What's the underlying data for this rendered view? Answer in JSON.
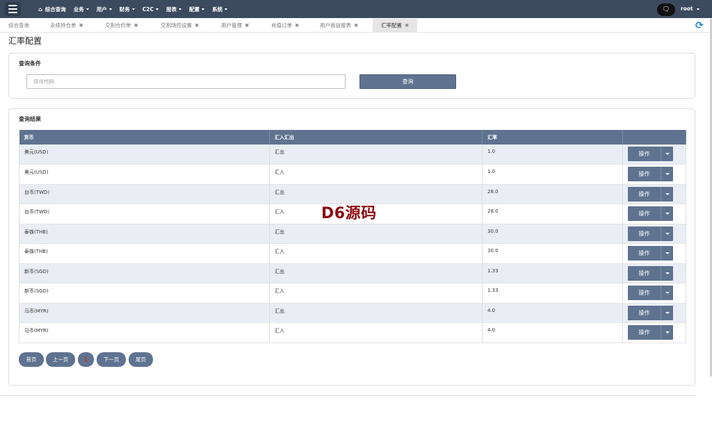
{
  "navbar": {
    "menu": [
      {
        "label": "综合查询",
        "icon": "home-icon",
        "has_dropdown": false
      },
      {
        "label": "业务",
        "has_dropdown": true
      },
      {
        "label": "用户",
        "has_dropdown": true
      },
      {
        "label": "财务",
        "has_dropdown": true
      },
      {
        "label": "C2C",
        "has_dropdown": true
      },
      {
        "label": "报表",
        "has_dropdown": true
      },
      {
        "label": "配置",
        "has_dropdown": true
      },
      {
        "label": "系统",
        "has_dropdown": true
      }
    ],
    "chat_icon": "chat-bubble-icon",
    "user": "root"
  },
  "tabs": [
    {
      "label": "综合查询",
      "closable": false
    },
    {
      "label": "永续持仓单",
      "closable": true
    },
    {
      "label": "交割合约单",
      "closable": true
    },
    {
      "label": "交割场控设置",
      "closable": true
    },
    {
      "label": "用户管理",
      "closable": true
    },
    {
      "label": "充值订单",
      "closable": true
    },
    {
      "label": "用户收益报表",
      "closable": true
    },
    {
      "label": "汇率配置",
      "closable": true,
      "active": true
    }
  ],
  "close_glyph": "✖",
  "page_title": "汇率配置",
  "query_panel": {
    "title": "查询条件",
    "currency_placeholder": "货币代码",
    "currency_value": "",
    "query_button": "查询"
  },
  "result_panel": {
    "title": "查询结果",
    "columns": [
      "货币",
      "汇入汇出",
      "汇率",
      ""
    ],
    "rows": [
      {
        "currency": "美元(USD)",
        "direction": "汇出",
        "rate": "1.0",
        "action": "操作"
      },
      {
        "currency": "美元(USD)",
        "direction": "汇入",
        "rate": "1.0",
        "action": "操作"
      },
      {
        "currency": "台币(TWD)",
        "direction": "汇出",
        "rate": "28.0",
        "action": "操作"
      },
      {
        "currency": "台币(TWD)",
        "direction": "汇入",
        "rate": "28.0",
        "action": "操作"
      },
      {
        "currency": "泰铢(THB)",
        "direction": "汇出",
        "rate": "30.0",
        "action": "操作"
      },
      {
        "currency": "泰铢(THB)",
        "direction": "汇入",
        "rate": "30.0",
        "action": "操作"
      },
      {
        "currency": "新币(SGD)",
        "direction": "汇出",
        "rate": "1.33",
        "action": "操作"
      },
      {
        "currency": "新币(SGD)",
        "direction": "汇入",
        "rate": "1.33",
        "action": "操作"
      },
      {
        "currency": "马币(MYR)",
        "direction": "汇出",
        "rate": "4.0",
        "action": "操作"
      },
      {
        "currency": "马币(MYR)",
        "direction": "汇入",
        "rate": "4.0",
        "action": "操作"
      }
    ]
  },
  "pagination": {
    "first": "首页",
    "prev": "上一页",
    "current": "1",
    "next": "下一页",
    "last": "尾页"
  },
  "watermark": "D6源码",
  "colors": {
    "navbar_bg": "#3b4a5f",
    "button_bg": "#5f7390",
    "row_stripe": "#eaeef4",
    "watermark": "#8b0d12",
    "refresh": "#1e88d8"
  }
}
